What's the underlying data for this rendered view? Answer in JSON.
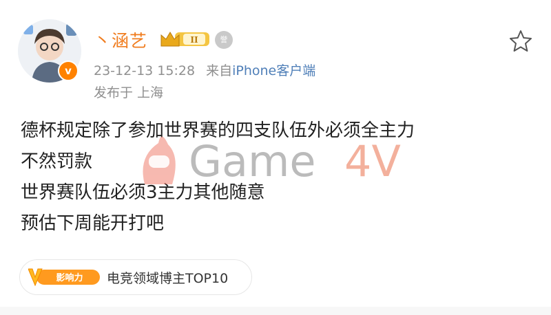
{
  "header": {
    "username": "丶涵艺",
    "level_badge": "II",
    "medal_glyph": "誉",
    "verified_glyph": "v",
    "timestamp": "23-12-13 15:28",
    "source_prefix": "来自",
    "client": "iPhone客户端",
    "location": "发布于 上海"
  },
  "post": {
    "lines": [
      "德杯规定除了参加世界赛的四支队伍外必须全主力",
      "不然罚款",
      "世界赛队伍必须3主力其他随意",
      "预估下周能开打吧"
    ]
  },
  "watermark": {
    "text": "Game4V"
  },
  "tag": {
    "badge_text": "影响力",
    "label": "电竞领域博主TOP10"
  },
  "colors": {
    "username": "#f07c1e",
    "meta": "#8f8f8f",
    "client_link": "#4f7fb8",
    "verified_badge": "#ff8200",
    "tag_badge": "#ff9a1f"
  },
  "icons": [
    "avatar",
    "verified-icon",
    "crown-level-icon",
    "medal-icon",
    "star-icon",
    "influence-v-icon"
  ]
}
